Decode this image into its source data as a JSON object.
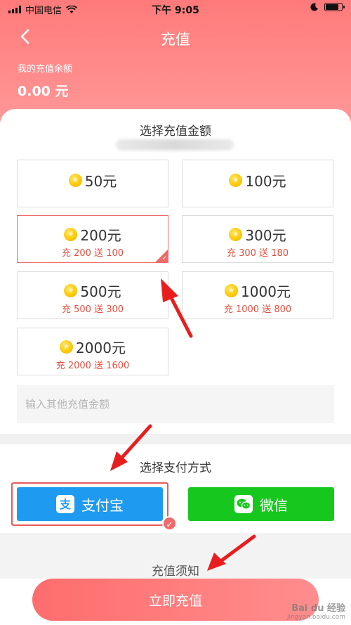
{
  "status_bar": {
    "carrier": "中国电信",
    "time": "下午 9:05"
  },
  "header": {
    "title": "充值",
    "balance_label": "我的充值余额",
    "balance_value": "0.00 元"
  },
  "amount_section": {
    "title": "选择充值金额",
    "options": [
      {
        "amount": "50元",
        "bonus": "",
        "selected": false
      },
      {
        "amount": "100元",
        "bonus": "",
        "selected": false
      },
      {
        "amount": "200元",
        "bonus": "充 200 送 100",
        "selected": true
      },
      {
        "amount": "300元",
        "bonus": "充 300 送 180",
        "selected": false
      },
      {
        "amount": "500元",
        "bonus": "充 500 送 300",
        "selected": false
      },
      {
        "amount": "1000元",
        "bonus": "充 1000 送 800",
        "selected": false
      },
      {
        "amount": "2000元",
        "bonus": "充 2000 送 1600",
        "selected": false
      }
    ],
    "custom_placeholder": "输入其他充值金额"
  },
  "payment_section": {
    "title": "选择支付方式",
    "methods": [
      {
        "label": "支付宝",
        "icon": "alipay-icon",
        "color": "#1e9bf0",
        "selected": true
      },
      {
        "label": "微信",
        "icon": "wechat-icon",
        "color": "#16c81d",
        "selected": false
      }
    ]
  },
  "notice": {
    "title": "充值须知"
  },
  "action": {
    "recharge_label": "立即充值"
  },
  "watermark": {
    "brand": "Bai du 经验",
    "url": "jingyan.baidu.com"
  },
  "colors": {
    "header": "#ff7a7a",
    "accent": "#f06a6a",
    "alipay": "#1e9bf0",
    "wechat": "#16c81d"
  }
}
